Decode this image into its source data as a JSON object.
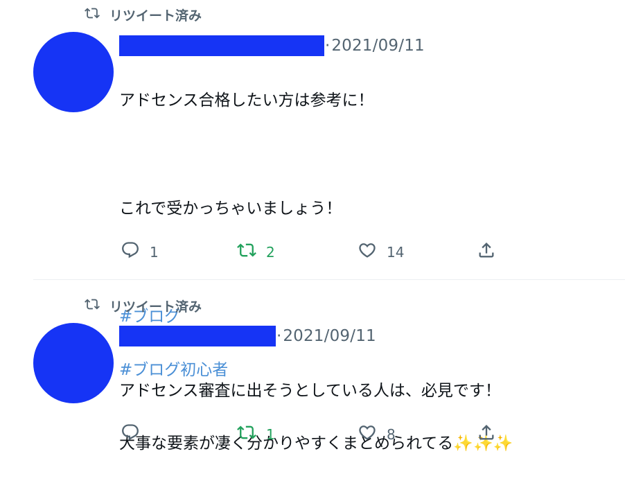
{
  "tweets": [
    {
      "retweet_label": "リツイート済み",
      "date": "2021/09/11",
      "separator": "·",
      "text_lines": [
        "アドセンス合格したい方は参考に！",
        "",
        "これで受かっちゃいましょう！"
      ],
      "hashtags": [
        "#ブログ",
        "#ブログ初心者"
      ],
      "actions": {
        "reply": "1",
        "retweet": "2",
        "like": "14"
      }
    },
    {
      "retweet_label": "リツイート済み",
      "date": "2021/09/11",
      "separator": "·",
      "text_line1": "アドセンス審査に出そうとしている人は、必見です！",
      "text_line2": "大事な要素が凄く分かりやすくまとめられてる",
      "sparkles": "✨✨✨",
      "actions": {
        "reply": "",
        "retweet": "1",
        "like": "8"
      }
    }
  ],
  "colors": {
    "avatar": "#1634f5",
    "retweet_active": "#22a15c",
    "hashtag": "#4a8fd6",
    "muted": "#536471"
  },
  "icons": [
    "retweet-icon",
    "reply-icon",
    "like-icon",
    "share-icon"
  ]
}
